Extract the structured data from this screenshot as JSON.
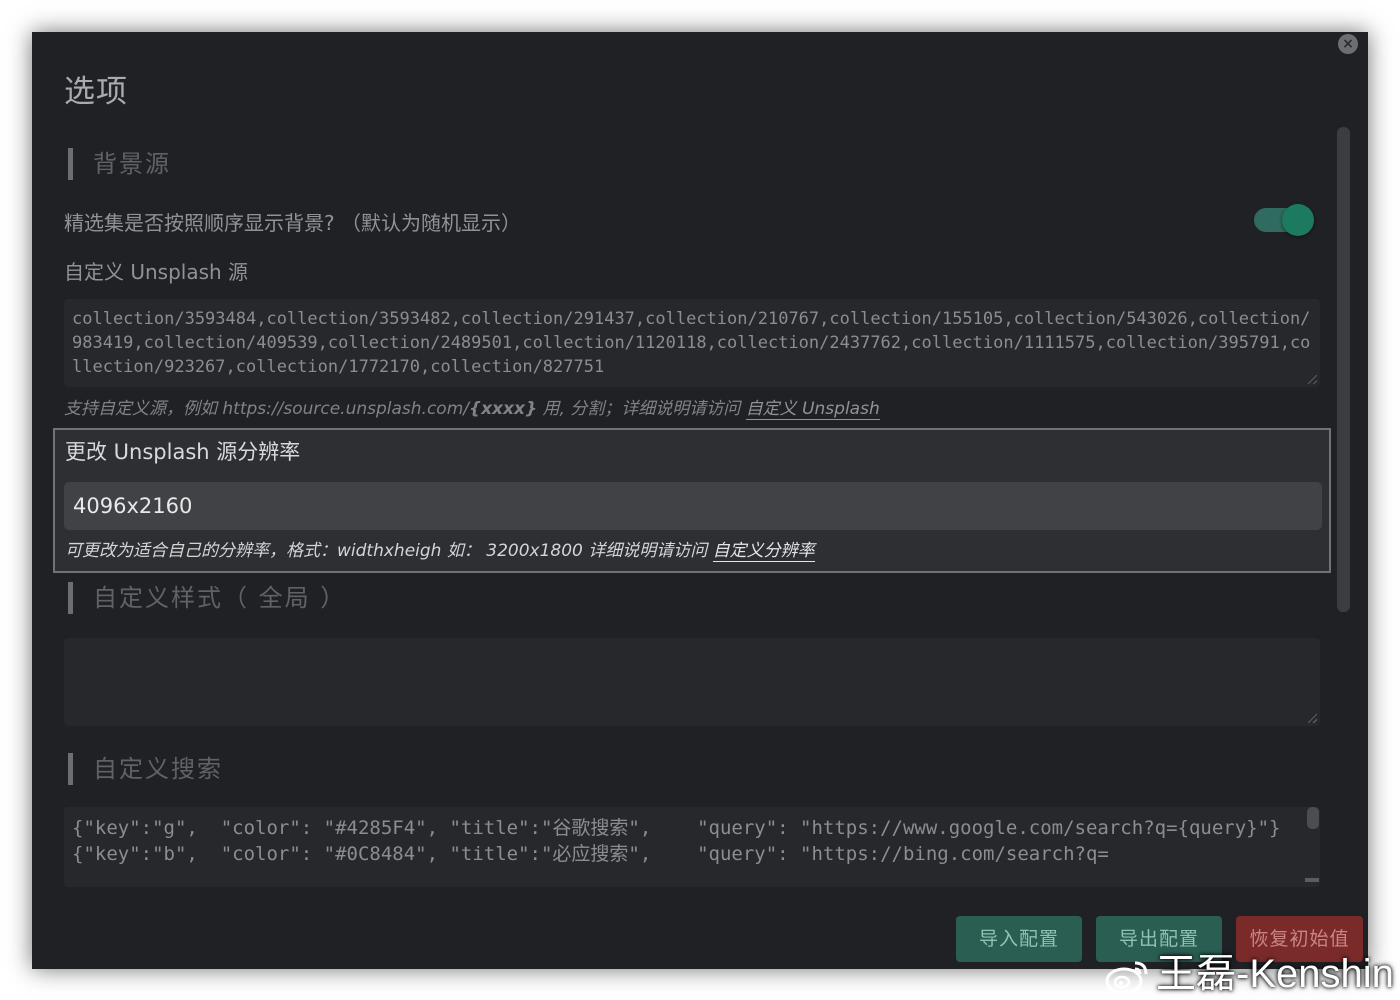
{
  "dialog": {
    "title": "选项",
    "close_icon": "close-icon"
  },
  "background_section": {
    "heading": "背景源",
    "sequential_label": "精选集是否按照顺序显示背景? （默认为随机显示）",
    "sequential_toggle_on": true,
    "custom_source_label": "自定义 Unsplash 源",
    "custom_source_value": "collection/3593484,collection/3593482,collection/291437,collection/210767,collection/155105,collection/543026,collection/983419,collection/409539,collection/2489501,collection/1120118,collection/2437762,collection/1111575,collection/395791,collection/923267,collection/1772170,collection/827751",
    "hint_prefix": "支持自定义源，例如 https://source.unsplash.com/",
    "hint_bold": "{xxxx}",
    "hint_suffix": " 用, 分割；详细说明请访问 ",
    "hint_link": "自定义 Unsplash"
  },
  "resolution": {
    "label": "更改 Unsplash 源分辨率",
    "value": "4096x2160",
    "hint": "可更改为适合自己的分辨率，格式：widthxheigh 如： 3200x1800 详细说明请访问 ",
    "hint_link": "自定义分辨率"
  },
  "style_section": {
    "heading": "自定义样式（ 全局 ）",
    "value": ""
  },
  "search_section": {
    "heading": "自定义搜索",
    "value": "{\"key\":\"g\",  \"color\": \"#4285F4\", \"title\":\"谷歌搜索\",    \"query\": \"https://www.google.com/search?q={query}\"}\n{\"key\":\"b\",  \"color\": \"#0C8484\", \"title\":\"必应搜索\",    \"query\": \"https://bing.com/search?q="
  },
  "buttons": {
    "import": "导入配置",
    "export": "导出配置",
    "reset": "恢复初始值"
  },
  "watermark": {
    "text": "王磊-Kenshin",
    "logo_icon": "weibo-logo-icon"
  },
  "colors": {
    "dialog_bg": "#1f2125",
    "accent_green": "#2a5e53",
    "danger_red": "#7b2a2a"
  }
}
